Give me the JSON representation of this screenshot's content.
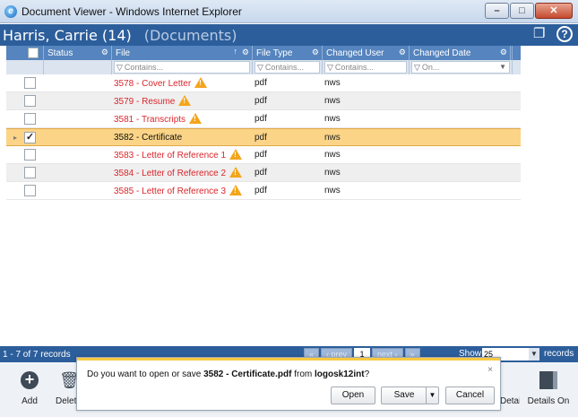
{
  "window": {
    "title": "Document Viewer - Windows Internet Explorer",
    "minimize": "–",
    "maximize": "□",
    "close": "✕"
  },
  "header": {
    "title": "Harris, Carrie (14)",
    "subtitle": "(Documents)",
    "pin_icon": "pin-icon",
    "help_icon": "help-icon",
    "help_glyph": "?"
  },
  "columns": {
    "status": "Status",
    "file": "File",
    "file_type": "File Type",
    "changed_user": "Changed User",
    "changed_date": "Changed Date",
    "sort_indicator": "↑"
  },
  "filters": {
    "file": "Contains...",
    "file_type": "Contains...",
    "changed_user": "Contains...",
    "changed_date": "On..."
  },
  "rows": [
    {
      "file": "3578 - Cover Letter",
      "type": "pdf",
      "user": "nws",
      "warning": true,
      "checked": false,
      "selected": false
    },
    {
      "file": "3579 - Resume",
      "type": "pdf",
      "user": "nws",
      "warning": true,
      "checked": false,
      "selected": false
    },
    {
      "file": "3581 - Transcripts",
      "type": "pdf",
      "user": "nws",
      "warning": true,
      "checked": false,
      "selected": false
    },
    {
      "file": "3582 - Certificate",
      "type": "pdf",
      "user": "nws",
      "warning": false,
      "checked": true,
      "selected": true
    },
    {
      "file": "3583 - Letter of Reference 1",
      "type": "pdf",
      "user": "nws",
      "warning": true,
      "checked": false,
      "selected": false
    },
    {
      "file": "3584 - Letter of Reference 2",
      "type": "pdf",
      "user": "nws",
      "warning": true,
      "checked": false,
      "selected": false
    },
    {
      "file": "3585 - Letter of Reference 3",
      "type": "pdf",
      "user": "nws",
      "warning": true,
      "checked": false,
      "selected": false
    }
  ],
  "statusbar": {
    "records_text": "1 - 7 of 7 records",
    "first": "«",
    "prev": "‹ prev",
    "page": "1",
    "next": "next ›",
    "last": "»",
    "show_label": "Show",
    "show_value": "25",
    "records_label": "records"
  },
  "toolbar": {
    "add_label": "Add",
    "delete_label": "Delete",
    "details_label": "Details",
    "details_on_label": "Details On"
  },
  "download": {
    "prefix": "Do you want to open or save ",
    "filename": "3582 - Certificate.pdf",
    "from": " from ",
    "source": "logosk12int",
    "suffix": "?",
    "open_label": "Open",
    "save_label": "Save",
    "cancel_label": "Cancel",
    "close_glyph": "×"
  },
  "colors": {
    "header_blue": "#2c5e9b",
    "selected_row": "#fbd487",
    "warning": "#f3a51b",
    "file_red": "#d9262b"
  }
}
